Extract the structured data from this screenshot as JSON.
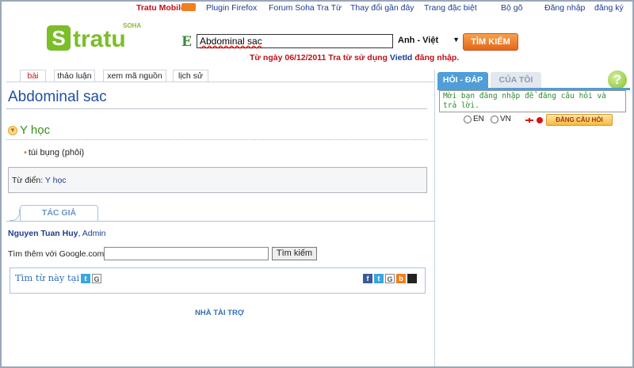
{
  "topnav": {
    "mobile": "Tratu Mobile",
    "plugin": "Plugin Firefox",
    "forum": "Forum Soha Tra Từ",
    "recent": "Thay đổi gần đây",
    "special": "Trang đặc biệt",
    "typing": "Bộ gõ",
    "login": "Đăng nhập",
    "register": "đăng ký"
  },
  "logo": {
    "soha": "SOHA",
    "s": "S",
    "word": "tratu"
  },
  "search": {
    "dict_icon": "E",
    "value": "Abdominal sac",
    "language": "Anh - Việt",
    "button": "TÌM KIẾM"
  },
  "notice": {
    "prefix": "Từ ngày 06/12/2011 Tra từ sử dụng",
    "vietid": "VietId",
    "suffix": "đăng nhập."
  },
  "article_tabs": [
    "bài",
    "thảo luận",
    "xem mã nguồn",
    "lịch sử"
  ],
  "entry": {
    "title": "Abdominal sac",
    "section": "Y học",
    "meaning": "túi bụng (phôi)",
    "dict_label": "Từ điển:",
    "dict_value": "Y học"
  },
  "authors": {
    "tab": "TÁC GIẢ",
    "name": "Nguyen Tuan Huy",
    "separator": ",",
    "role": "Admin"
  },
  "google": {
    "label": "Tìm thêm với Google.com :",
    "button": "Tìm kiếm"
  },
  "share": {
    "label": "Tìm từ này tại :"
  },
  "sponsor": "NHÀ TÀI TRỢ",
  "qa": {
    "tab_qa": "HỎI - ĐÁP",
    "tab_mine": "CỦA TÔI",
    "placeholder": "Mời bạn đăng nhập để đăng câu hỏi và trả lời.",
    "lang_en": "EN",
    "lang_vn": "VN",
    "ask_button": "ĐĂNG CÂU HỎI"
  }
}
